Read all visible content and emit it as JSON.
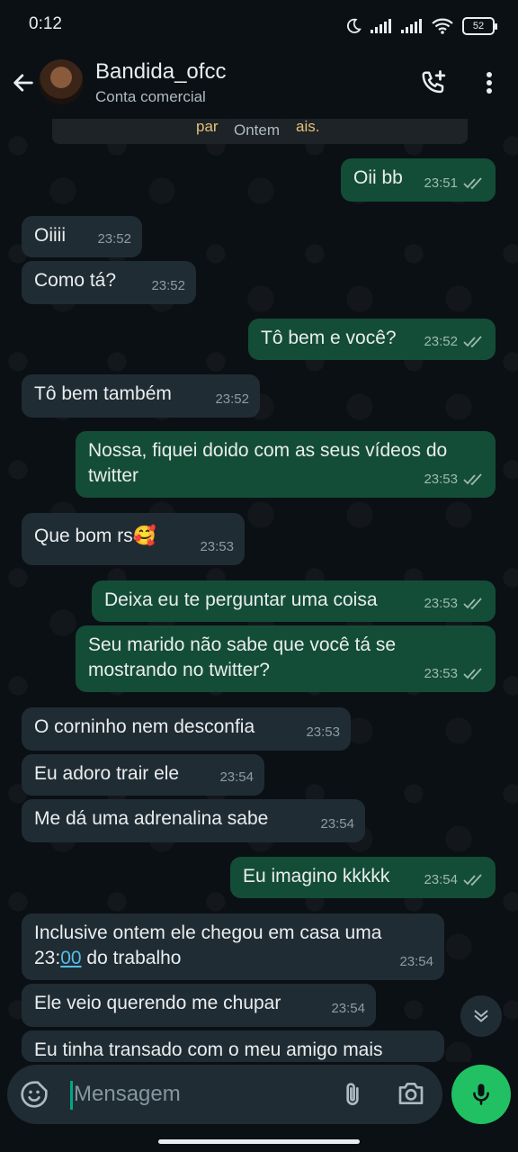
{
  "status_bar": {
    "time": "0:12",
    "battery": "52"
  },
  "header": {
    "contact_name": "Bandida_ofcc",
    "contact_subtitle": "Conta comercial",
    "icons": {
      "back": "arrow-left-icon",
      "call": "add-call-icon",
      "menu": "more-vertical-icon"
    }
  },
  "chat": {
    "system_banner_fragment_left": "par",
    "system_banner_fragment_right": "ais.",
    "date_label": "Ontem",
    "messages": [
      {
        "dir": "out",
        "text": "Oii bb",
        "time": "23:51"
      },
      {
        "dir": "in",
        "text": "Oiiii",
        "time": "23:52"
      },
      {
        "dir": "in",
        "text": "Como tá?",
        "time": "23:52"
      },
      {
        "dir": "out",
        "text": "Tô bem e você?",
        "time": "23:52"
      },
      {
        "dir": "in",
        "text": "Tô bem também",
        "time": "23:52"
      },
      {
        "dir": "out",
        "text": "Nossa, fiquei doido com as seus vídeos do twitter",
        "time": "23:53"
      },
      {
        "dir": "in",
        "text": "Que bom rs",
        "emoji": "🥰",
        "time": "23:53"
      },
      {
        "dir": "out",
        "text": "Deixa eu te perguntar uma coisa",
        "time": "23:53"
      },
      {
        "dir": "out",
        "text": "Seu marido não sabe que você tá se mostrando no twitter?",
        "time": "23:53"
      },
      {
        "dir": "in",
        "text": "O corninho nem desconfia",
        "time": "23:53"
      },
      {
        "dir": "in",
        "text": "Eu adoro trair ele",
        "time": "23:54"
      },
      {
        "dir": "in",
        "text": "Me dá uma adrenalina sabe",
        "time": "23:54"
      },
      {
        "dir": "out",
        "text": "Eu imagino kkkkk",
        "time": "23:54"
      },
      {
        "dir": "in",
        "text_before": "Inclusive ontem ele chegou em casa uma 23:",
        "text_link": "00",
        "text_after": " do trabalho",
        "time": "23:54"
      },
      {
        "dir": "in",
        "text": "Ele veio querendo me chupar",
        "time": "23:54"
      },
      {
        "dir": "in",
        "text": "Eu tinha transado com o meu amigo mais"
      }
    ],
    "scroll_down_icon": "double-chevron-down-icon"
  },
  "composer": {
    "placeholder": "Mensagem",
    "icons": {
      "emoji": "sticker-emoji-icon",
      "attach": "paperclip-icon",
      "camera": "camera-icon",
      "mic": "microphone-icon"
    }
  },
  "colors": {
    "incoming": "#202c33",
    "outgoing": "#144d37",
    "accent": "#21c063",
    "background": "#0b1014"
  }
}
